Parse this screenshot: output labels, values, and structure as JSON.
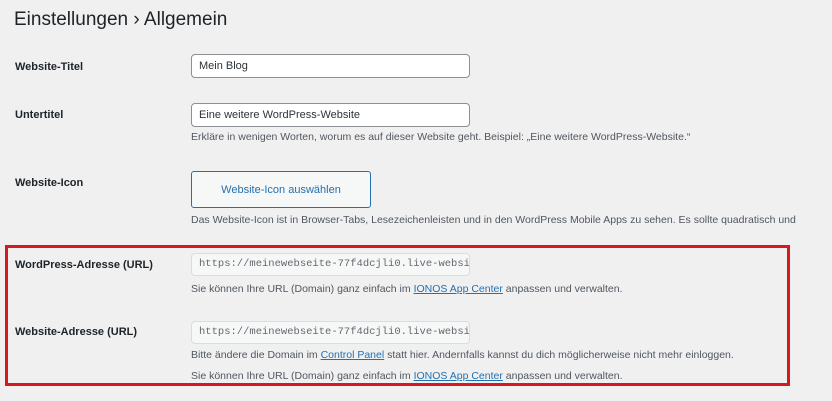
{
  "page": {
    "title": "Einstellungen › Allgemein"
  },
  "fields": {
    "site_title": {
      "label": "Website-Titel",
      "value": "Mein Blog"
    },
    "tagline": {
      "label": "Untertitel",
      "value": "Eine weitere WordPress-Website",
      "description": "Erkläre in wenigen Worten, worum es auf dieser Website geht. Beispiel: „Eine weitere WordPress-Website.“"
    },
    "site_icon": {
      "label": "Website-Icon",
      "button_label": "Website-Icon auswählen",
      "description": "Das Website-Icon ist in Browser-Tabs, Lesezeichenleisten und in den WordPress Mobile Apps zu sehen. Es sollte quadratisch und"
    },
    "wp_address": {
      "label": "WordPress-Adresse (URL)",
      "value": "https://meinewebseite-77f4dcjli0.live-websi",
      "desc_before": "Sie können Ihre URL (Domain) ganz einfach im ",
      "desc_link": "IONOS App Center",
      "desc_after": " anpassen und verwalten."
    },
    "site_address": {
      "label": "Website-Adresse (URL)",
      "value": "https://meinewebseite-77f4dcjli0.live-websi",
      "desc1_before": "Bitte ändere die Domain im ",
      "desc1_link": "Control Panel",
      "desc1_after": " statt hier. Andernfalls kannst du dich möglicherweise nicht mehr einloggen.",
      "desc2_before": "Sie können Ihre URL (Domain) ganz einfach im ",
      "desc2_link": "IONOS App Center",
      "desc2_after": " anpassen und verwalten."
    }
  },
  "colors": {
    "highlight": "#d7191f",
    "link": "#2271b1",
    "background": "#f0f0f1"
  }
}
